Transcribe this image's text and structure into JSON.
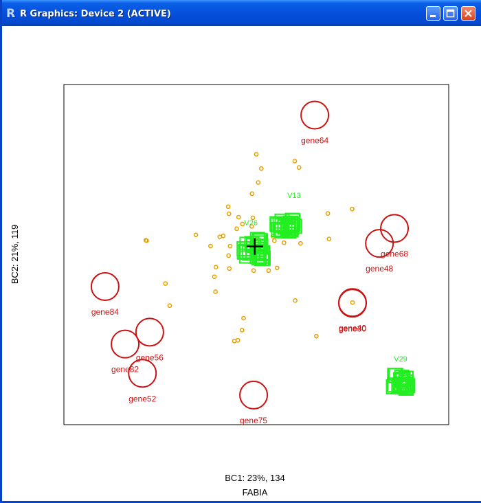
{
  "window": {
    "title": "R Graphics: Device 2 (ACTIVE)",
    "icon": "r-logo-icon",
    "controls": [
      "minimize-icon",
      "maximize-icon",
      "close-icon"
    ],
    "title_bar_color": "#0550dc"
  },
  "chart_data": {
    "type": "scatter",
    "title": "",
    "xlabel": "BC1: 23%,  134",
    "ylabel": "BC2: 21%,  119",
    "caption": "FABIA",
    "xlim": [
      0,
      100
    ],
    "ylim": [
      0,
      100
    ],
    "grid": false,
    "colors": {
      "genes": "#cc1111",
      "gene_points": "#e8a000",
      "samples": "#22ee22",
      "center": "#000000"
    },
    "gene_circles": [
      {
        "label": "gene64",
        "x": 65.2,
        "y": 91.0
      },
      {
        "label": "gene68",
        "x": 85.9,
        "y": 57.7
      },
      {
        "label": "gene48",
        "x": 82.0,
        "y": 53.3
      },
      {
        "label": "gene84",
        "x": 10.7,
        "y": 40.6
      },
      {
        "label": "gene40",
        "x": 75.0,
        "y": 35.9
      },
      {
        "label": "gene30",
        "x": 75.0,
        "y": 35.7
      },
      {
        "label": "gene56",
        "x": 22.3,
        "y": 27.2
      },
      {
        "label": "gene82",
        "x": 15.9,
        "y": 23.7
      },
      {
        "label": "gene52",
        "x": 20.4,
        "y": 15.1
      },
      {
        "label": "gene75",
        "x": 49.3,
        "y": 8.7
      }
    ],
    "gene_points": [
      [
        50.0,
        79.5
      ],
      [
        60.0,
        77.5
      ],
      [
        61.1,
        75.6
      ],
      [
        50.5,
        71.2
      ],
      [
        51.3,
        75.3
      ],
      [
        48.9,
        67.9
      ],
      [
        42.7,
        64.1
      ],
      [
        42.9,
        62.0
      ],
      [
        45.4,
        61.0
      ],
      [
        49.1,
        60.8
      ],
      [
        46.4,
        59.0
      ],
      [
        48.8,
        58.3
      ],
      [
        44.9,
        57.6
      ],
      [
        40.5,
        55.2
      ],
      [
        57.9,
        55.4
      ],
      [
        60.4,
        56.1
      ],
      [
        54.3,
        55.4
      ],
      [
        34.3,
        55.8
      ],
      [
        43.2,
        52.5
      ],
      [
        54.7,
        54.1
      ],
      [
        38.1,
        52.5
      ],
      [
        50.2,
        54.6
      ],
      [
        68.9,
        54.6
      ],
      [
        57.2,
        53.5
      ],
      [
        58.2,
        55.4
      ],
      [
        21.5,
        54.1
      ],
      [
        52.3,
        50.8
      ],
      [
        42.8,
        49.7
      ],
      [
        39.5,
        46.3
      ],
      [
        43.0,
        45.9
      ],
      [
        55.4,
        46.1
      ],
      [
        49.3,
        45.3
      ],
      [
        53.2,
        45.3
      ],
      [
        39.1,
        43.5
      ],
      [
        61.5,
        53.3
      ],
      [
        26.4,
        41.5
      ],
      [
        39.4,
        39.1
      ],
      [
        27.5,
        35.0
      ],
      [
        60.1,
        36.5
      ],
      [
        75.0,
        35.9
      ],
      [
        46.7,
        31.3
      ],
      [
        46.3,
        27.8
      ],
      [
        65.6,
        26.0
      ],
      [
        45.2,
        24.8
      ],
      [
        44.3,
        24.6
      ],
      [
        74.9,
        63.4
      ],
      [
        41.4,
        55.5
      ],
      [
        68.6,
        62.1
      ],
      [
        21.3,
        54.2
      ]
    ],
    "sample_cluster_center": [
      57.7,
      58.4
    ],
    "sample_cluster_center2": [
      49.3,
      51.8
    ],
    "sample_cluster_corner": [
      87.4,
      12.7
    ],
    "sample_labels": [
      {
        "label": "V13",
        "x": 59.8,
        "y": 66.7
      },
      {
        "label": "V26",
        "x": 48.6,
        "y": 58.6
      },
      {
        "label": "V29",
        "x": 87.5,
        "y": 18.6
      }
    ],
    "center_marker": [
      49.6,
      52.4
    ]
  }
}
